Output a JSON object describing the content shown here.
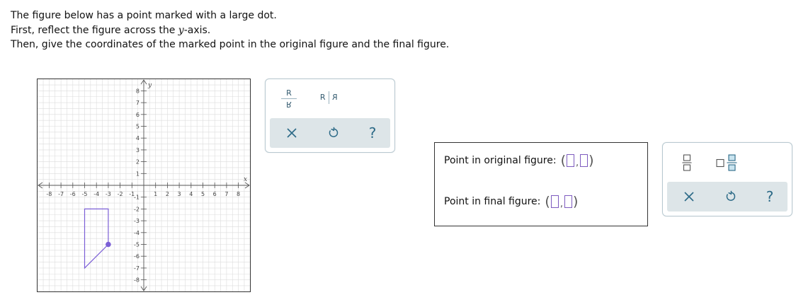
{
  "instructions": {
    "line1": "The figure below has a point marked with a large dot.",
    "line2_before": "First, reflect the figure across the ",
    "line2_var": "y",
    "line2_after": "-axis.",
    "line3": "Then, give the coordinates of the marked point in the original figure and the final figure."
  },
  "graph": {
    "x_axis_label": "x",
    "y_axis_label": "y",
    "x_tick_labels": [
      "-8",
      "-7",
      "-6",
      "-5",
      "-4",
      "-3",
      "-2",
      "-1",
      "1",
      "2",
      "3",
      "4",
      "5",
      "6",
      "7",
      "8"
    ],
    "y_tick_labels": [
      "8",
      "7",
      "6",
      "5",
      "4",
      "3",
      "2",
      "1",
      "-1",
      "-2",
      "-3",
      "-4",
      "-5",
      "-6",
      "-7",
      "-8"
    ],
    "xlim": [
      -8,
      8
    ],
    "ylim": [
      -8,
      8
    ],
    "polygon_vertices": [
      [
        -5,
        -2
      ],
      [
        -3,
        -2
      ],
      [
        -3,
        -5
      ],
      [
        -5,
        -7
      ]
    ],
    "marked_point": [
      -3,
      -5
    ],
    "figure_color": "#7b5fd6",
    "grid_color": "#dcdcdc",
    "axis_color": "#555555"
  },
  "reflect_tool": {
    "vertical_top": "R",
    "vertical_bottom": "R",
    "horizontal_left": "R",
    "horizontal_right": "R",
    "help_glyph": "?",
    "icons": [
      "reflect-vertical-icon",
      "reflect-horizontal-icon",
      "close-icon",
      "undo-icon",
      "help-icon"
    ]
  },
  "answers": {
    "original_label": "Point in original figure:",
    "final_label": "Point in final figure:",
    "open_paren": "(",
    "close_paren": ")",
    "comma": ","
  },
  "fraction_tool": {
    "help_glyph": "?",
    "icons": [
      "fraction-icon",
      "mixed-number-icon",
      "close-icon",
      "undo-icon",
      "help-icon"
    ]
  },
  "colors": {
    "accent": "#2c6a87",
    "input_border": "#7d5bbf",
    "panel_bar": "#dde5e8"
  }
}
